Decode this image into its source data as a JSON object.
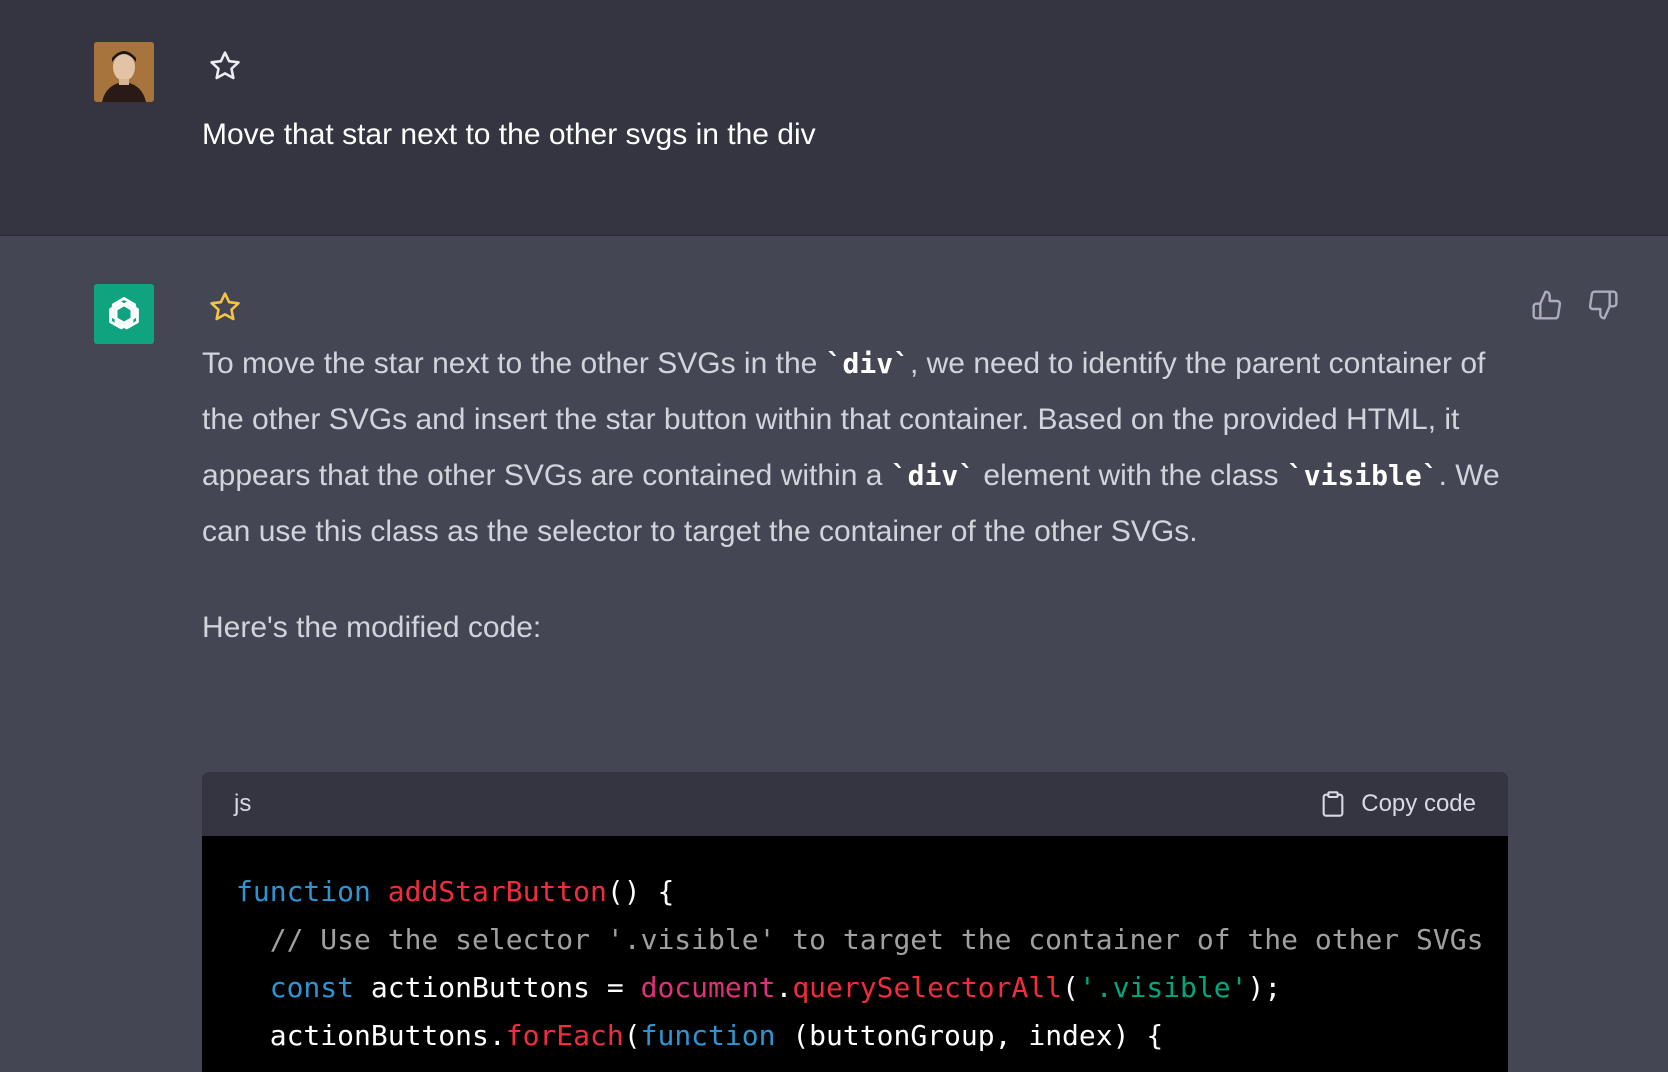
{
  "user_message": {
    "text": "Move that star next to the other svgs in the div",
    "star_color": "#ececf1"
  },
  "assistant_message": {
    "star_color": "#f5c542",
    "paragraph1": {
      "t1": "To move the star next to the other SVGs in the ",
      "c1": "`div`",
      "t2": ", we need to identify the parent container of the other SVGs and insert the star button within that container. Based on the provided HTML, it appears that the other SVGs are contained within a ",
      "c2": "`div`",
      "t3": " element with the class ",
      "c3": "`visible`",
      "t4": ". We can use this class as the selector to target the container of the other SVGs."
    },
    "paragraph2": "Here's the modified code:"
  },
  "code_block": {
    "language": "js",
    "copy_label": "Copy code",
    "line1": {
      "kw": "function",
      "fn": "addStarButton",
      "rest": "() {"
    },
    "line2": {
      "comment": "// Use the selector '.visible' to target the container of the other SVGs"
    },
    "line3": {
      "kw": "const",
      "var": " actionButtons = ",
      "obj": "document",
      "dot": ".",
      "fn": "querySelectorAll",
      "open": "(",
      "str": "'.visible'",
      "close": ");"
    },
    "line4": {
      "var": "actionButtons.",
      "fn": "forEach",
      "open": "(",
      "kw": "function",
      "rest": " (buttonGroup, index) {"
    }
  },
  "colors": {
    "user_bg": "#343541",
    "assistant_bg": "#444654",
    "gpt_avatar": "#10a37f"
  }
}
